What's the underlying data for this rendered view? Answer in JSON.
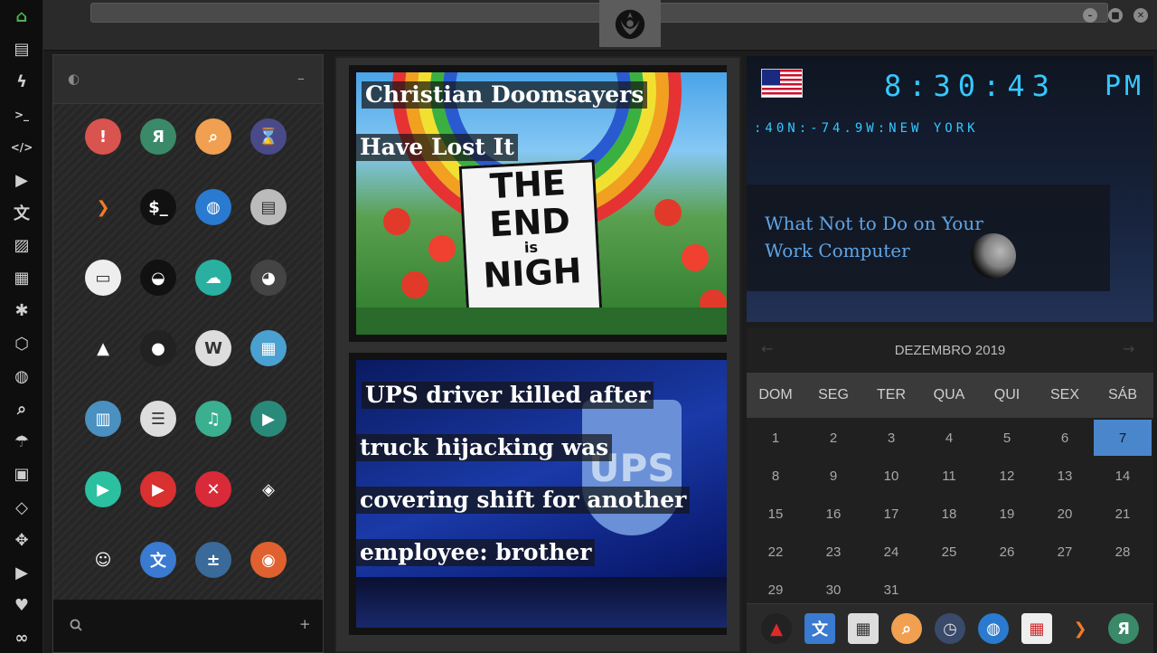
{
  "dock": {
    "items": [
      "home-icon",
      "document-icon",
      "bolt-icon",
      "terminal-icon",
      "code-icon",
      "play-icon",
      "translate-icon",
      "image-icon",
      "news-icon",
      "asterisk-icon",
      "hexagon-icon",
      "globe-icon",
      "search-icon",
      "umbrella-icon",
      "contacts-icon",
      "tag-icon",
      "expand-icon",
      "youtube-icon",
      "heart-icon",
      "infinity-icon"
    ],
    "accent": "#4caf50"
  },
  "launcher": {
    "header_icon": "◐",
    "minimize_label": "–",
    "add_label": "+",
    "search_icon": "search-icon",
    "apps": [
      {
        "name": "warning-icon",
        "bg": "#d9534f",
        "glyph": "!"
      },
      {
        "name": "yandex-icon",
        "bg": "#3a8a6a",
        "glyph": "Я"
      },
      {
        "name": "magnifier-icon",
        "bg": "#f0a050",
        "glyph": "⌕"
      },
      {
        "name": "hourglass-icon",
        "bg": "#4a4a8a",
        "glyph": "⌛"
      },
      {
        "name": "prompt-icon",
        "bg": "transparent",
        "glyph": "❯"
      },
      {
        "name": "shell-icon",
        "bg": "#111111",
        "glyph": "$_"
      },
      {
        "name": "globe-icon",
        "bg": "#2a7ad0",
        "glyph": "◍"
      },
      {
        "name": "scanner-icon",
        "bg": "#bbbbbb",
        "glyph": "▤"
      },
      {
        "name": "window-icon",
        "bg": "#eeeeee",
        "glyph": "▭"
      },
      {
        "name": "ubuntu-icon",
        "bg": "#111111",
        "glyph": "◒"
      },
      {
        "name": "cloud-lock-icon",
        "bg": "#2ab0a0",
        "glyph": "☁"
      },
      {
        "name": "github-icon",
        "bg": "#444444",
        "glyph": "◕"
      },
      {
        "name": "star-trek-icon",
        "bg": "transparent",
        "glyph": "▲"
      },
      {
        "name": "death-star-icon",
        "bg": "#222222",
        "glyph": "●"
      },
      {
        "name": "wikipedia-icon",
        "bg": "#dddddd",
        "glyph": "W"
      },
      {
        "name": "world-map-icon",
        "bg": "#4aa0d0",
        "glyph": "▦"
      },
      {
        "name": "library-icon",
        "bg": "#4a90c0",
        "glyph": "▥"
      },
      {
        "name": "notebook-icon",
        "bg": "#dddddd",
        "glyph": "☰"
      },
      {
        "name": "music-icon",
        "bg": "#3ab090",
        "glyph": "♫"
      },
      {
        "name": "video-icon",
        "bg": "#2a8a7a",
        "glyph": "▶"
      },
      {
        "name": "media-player-icon",
        "bg": "#2ac0a0",
        "glyph": "▶"
      },
      {
        "name": "youtube-app-icon",
        "bg": "#d93030",
        "glyph": "▶"
      },
      {
        "name": "close-app-icon",
        "bg": "#d92a3a",
        "glyph": "✕"
      },
      {
        "name": "iron-man-icon",
        "bg": "transparent",
        "glyph": "◈"
      },
      {
        "name": "c3po-icon",
        "bg": "transparent",
        "glyph": "☺"
      },
      {
        "name": "translate-app-icon",
        "bg": "#3a7ad0",
        "glyph": "文"
      },
      {
        "name": "calculator-icon",
        "bg": "#3a6a9a",
        "glyph": "±"
      },
      {
        "name": "photo-icon",
        "bg": "#e06030",
        "glyph": "◉"
      }
    ]
  },
  "news": {
    "cards": [
      {
        "headline_lines": [
          "Christian Doomsayers",
          "Have Lost It"
        ]
      },
      {
        "headline_lines": [
          "UPS driver killed after",
          "truck hijacking was",
          "covering shift for another",
          "employee: brother"
        ]
      }
    ],
    "sign_text": [
      "THE",
      "END",
      "is",
      "NIGH"
    ],
    "ups_text": "UPS"
  },
  "clock": {
    "time": "8:30:43",
    "ampm": "PM",
    "location": ":40N:-74.9W:NEW YORK",
    "article_title": "What Not to Do on Your Work Computer",
    "flag_icon": "us-flag-icon"
  },
  "calendar": {
    "month_label": "DEZEMBRO 2019",
    "weekdays": [
      "DOM",
      "SEG",
      "TER",
      "QUA",
      "QUI",
      "SEX",
      "SÁB"
    ],
    "weeks": [
      [
        "1",
        "2",
        "3",
        "4",
        "5",
        "6",
        "7"
      ],
      [
        "8",
        "9",
        "10",
        "11",
        "12",
        "13",
        "14"
      ],
      [
        "15",
        "16",
        "17",
        "18",
        "19",
        "20",
        "21"
      ],
      [
        "22",
        "23",
        "24",
        "25",
        "26",
        "27",
        "28"
      ],
      [
        "29",
        "30",
        "31",
        "",
        "",
        "",
        ""
      ]
    ],
    "selected_day": "7",
    "prev_label": "←",
    "next_label": "→"
  },
  "tray": {
    "items": [
      "arch-icon",
      "translate-icon",
      "news-reader-icon",
      "search-icon",
      "clock-icon",
      "globe-icon",
      "calendar-icon",
      "prompt-icon",
      "yandex-icon"
    ]
  }
}
